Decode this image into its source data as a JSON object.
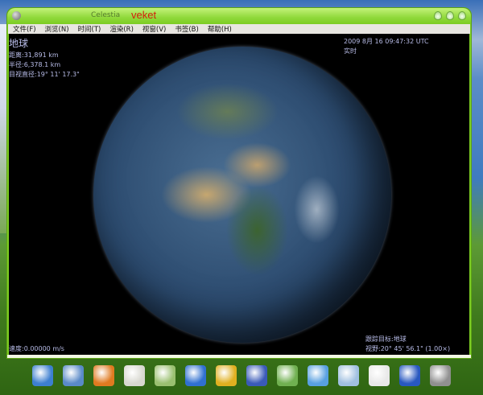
{
  "window": {
    "title": "Celestia",
    "brand": "veket"
  },
  "menu": [
    "文件(F)",
    "浏览(N)",
    "时间(T)",
    "渲染(R)",
    "视窗(V)",
    "书签(B)",
    "帮助(H)"
  ],
  "hud": {
    "object": "地球",
    "distance": "距离:31,891 km",
    "radius": "半径:6,378.1 km",
    "apparent_diameter": "目视直径:19° 11' 17.3\"",
    "datetime": "2009 8月 16 09:47:32 UTC",
    "time_mode": "实时",
    "speed": "速度:0.00000 m/s",
    "track": "跟踪目标:地球",
    "fov": "视野:20° 45' 56.1\" (1.00×)"
  },
  "dock": [
    {
      "name": "finder-icon",
      "color": "#3d7fd0"
    },
    {
      "name": "computer-icon",
      "color": "#5a8ac8"
    },
    {
      "name": "firefox-icon",
      "color": "#e07a20"
    },
    {
      "name": "text-editor-icon",
      "color": "#d8d8d0"
    },
    {
      "name": "music-player-icon",
      "color": "#9ac070"
    },
    {
      "name": "browser-globe-icon",
      "color": "#3070d0"
    },
    {
      "name": "aim-icon",
      "color": "#e0b020"
    },
    {
      "name": "document-icon",
      "color": "#3a5ab8"
    },
    {
      "name": "spreadsheet-icon",
      "color": "#70b050"
    },
    {
      "name": "image-viewer-icon",
      "color": "#58a0e0"
    },
    {
      "name": "usb-drive-icon",
      "color": "#a0c0e0"
    },
    {
      "name": "linux-icon",
      "color": "#e8e8e8"
    },
    {
      "name": "help-icon",
      "color": "#2858c0"
    },
    {
      "name": "camera-icon",
      "color": "#909090"
    }
  ]
}
